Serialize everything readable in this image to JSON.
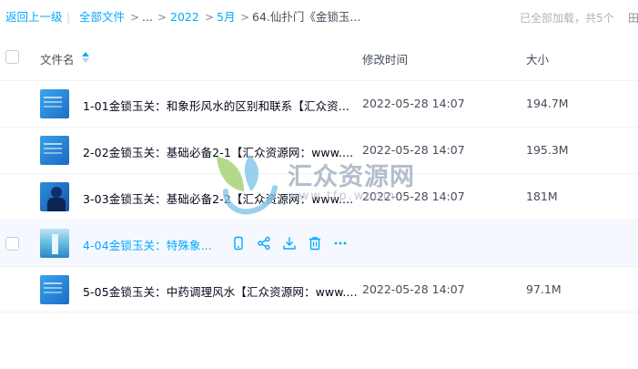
{
  "breadcrumb": {
    "back": "返回上一级",
    "separator": "|",
    "root": "全部文件",
    "ellipsis": "...",
    "year": "2022",
    "month": "5月",
    "current": "64.仙扑门《金锁玉...",
    "status": "已全部加载，共5个",
    "overflow": "田"
  },
  "columns": {
    "name": "文件名",
    "modified": "修改时间",
    "size": "大小"
  },
  "files": [
    {
      "name": "1-01金锁玉关：和象形风水的区别和联系【汇众资...",
      "modified": "2022-05-28 14:07",
      "size": "194.7M",
      "thumb": "#2a8fe0"
    },
    {
      "name": "2-02金锁玉关：基础必备2-1【汇众资源网：www....",
      "modified": "2022-05-28 14:07",
      "size": "195.3M",
      "thumb": "#1f86d6"
    },
    {
      "name": "3-03金锁玉关：基础必备2-2【汇众资源网：www....",
      "modified": "2022-05-28 14:07",
      "size": "181M",
      "thumb": "#2379cf"
    },
    {
      "name": "4-04金锁玉关：特殊象...",
      "modified": "",
      "size": "",
      "thumb": "#4ea7d6"
    },
    {
      "name": "5-05金锁玉关：中药调理风水【汇众资源网：www....",
      "modified": "2022-05-28 14:07",
      "size": "97.1M",
      "thumb": "#2088da"
    }
  ],
  "row_actions": [
    "phone-icon",
    "share-icon",
    "download-icon",
    "delete-icon",
    "more-icon"
  ],
  "watermark": {
    "title": "汇众资源网",
    "url": "www.tfp.wcom"
  },
  "colors": {
    "accent": "#06a7ff",
    "text": "#03081a",
    "muted": "#454d5a",
    "hover": "#f5f9ff"
  }
}
